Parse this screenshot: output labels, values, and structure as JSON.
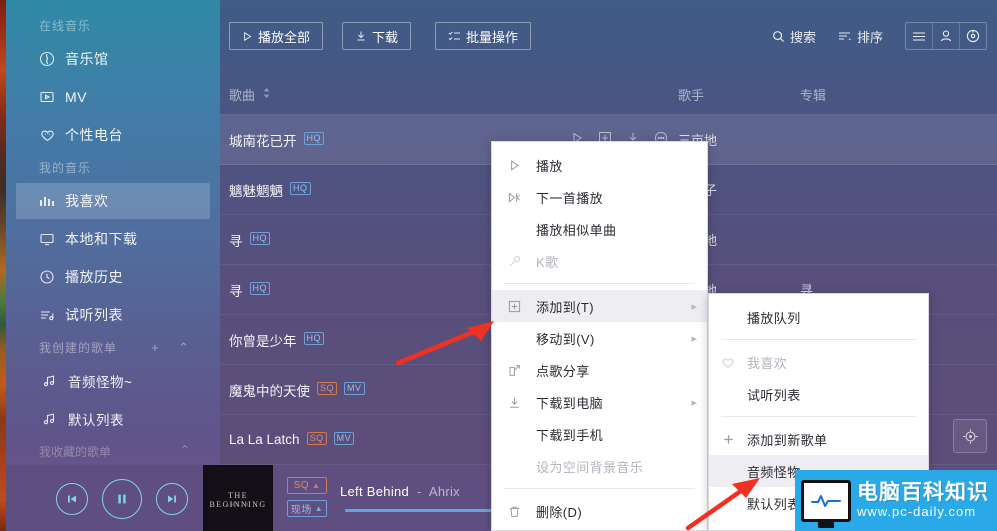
{
  "sidebar": {
    "groups": [
      {
        "title": "在线音乐",
        "items": [
          {
            "label": "音乐馆",
            "icon": "music-hall-icon"
          },
          {
            "label": "MV",
            "icon": "mv-icon"
          },
          {
            "label": "个性电台",
            "icon": "radio-heart-icon"
          }
        ]
      },
      {
        "title": "我的音乐",
        "items": [
          {
            "label": "我喜欢",
            "icon": "bars-icon",
            "active": true
          },
          {
            "label": "本地和下载",
            "icon": "monitor-icon"
          },
          {
            "label": "播放历史",
            "icon": "clock-icon"
          },
          {
            "label": "试听列表",
            "icon": "list-note-icon"
          }
        ]
      },
      {
        "title": "我创建的歌单",
        "add_label": "+",
        "collapse_label": "⌃",
        "items": [
          {
            "label": "音频怪物~",
            "icon": "note-icon"
          },
          {
            "label": "默认列表",
            "icon": "note-icon"
          }
        ]
      }
    ],
    "footer_group": {
      "title": "我收藏的歌单",
      "collapse_label": "⌃"
    }
  },
  "toolbar": {
    "play_all": "播放全部",
    "download": "下载",
    "batch": "批量操作",
    "search": "搜索",
    "sort": "排序",
    "menu_icon": "hamburger-icon",
    "user_icon": "user-icon",
    "skin_icon": "skin-disc-icon"
  },
  "columns": {
    "song": "歌曲",
    "artist": "歌手",
    "album": "专辑"
  },
  "rows": [
    {
      "title": "城南花已开",
      "badges": [
        {
          "t": "HQ",
          "k": "hq"
        }
      ],
      "artist": "三亩地",
      "album": "",
      "selected": true,
      "actions": [
        "play-icon",
        "add-icon",
        "download-icon",
        "more-icon"
      ]
    },
    {
      "title": "魑魅魍魉",
      "badges": [
        {
          "t": "HQ",
          "k": "hq"
        }
      ],
      "artist": "理理子",
      "album": ""
    },
    {
      "title": "寻",
      "badges": [
        {
          "t": "HQ",
          "k": "hq"
        }
      ],
      "artist": "三亩地",
      "album": ""
    },
    {
      "title": "寻",
      "badges": [
        {
          "t": "HQ",
          "k": "hq"
        }
      ],
      "artist": "三亩地",
      "album": "寻"
    },
    {
      "title": "你曾是少年",
      "badges": [
        {
          "t": "HQ",
          "k": "hq"
        }
      ],
      "artist": "",
      "album": ""
    },
    {
      "title": "魔鬼中的天使",
      "badges": [
        {
          "t": "SQ",
          "k": "sq"
        },
        {
          "t": "MV",
          "k": "mv"
        }
      ],
      "artist": "",
      "album": ""
    },
    {
      "title": "La La Latch",
      "badges": [
        {
          "t": "SQ",
          "k": "sq"
        },
        {
          "t": "MV",
          "k": "mv"
        }
      ],
      "artist": "",
      "album": ""
    }
  ],
  "context_menu": {
    "items": [
      {
        "label": "播放",
        "icon": "play-icon",
        "arrow": false,
        "disabled": false,
        "highlight": false
      },
      {
        "label": "下一首播放",
        "icon": "play-next-icon",
        "arrow": false,
        "disabled": false,
        "highlight": false
      },
      {
        "label": "播放相似单曲",
        "icon": "",
        "arrow": false,
        "disabled": false,
        "highlight": false
      },
      {
        "label": "K歌",
        "icon": "mic-icon",
        "arrow": false,
        "disabled": true,
        "highlight": false
      },
      {
        "sep": true
      },
      {
        "label": "添加到(T)",
        "icon": "plus-box-icon",
        "arrow": true,
        "disabled": false,
        "highlight": true
      },
      {
        "label": "移动到(V)",
        "icon": "",
        "arrow": true,
        "disabled": false,
        "highlight": false
      },
      {
        "label": "点歌分享",
        "icon": "share-icon",
        "arrow": false,
        "disabled": false,
        "highlight": false
      },
      {
        "label": "下载到电脑",
        "icon": "download-icon",
        "arrow": true,
        "disabled": false,
        "highlight": false
      },
      {
        "label": "下载到手机",
        "icon": "",
        "arrow": false,
        "disabled": false,
        "highlight": false
      },
      {
        "label": "设为空间背景音乐",
        "icon": "",
        "arrow": false,
        "disabled": true,
        "highlight": false
      },
      {
        "sep": true
      },
      {
        "label": "删除(D)",
        "icon": "trash-icon",
        "arrow": false,
        "disabled": false,
        "highlight": false
      }
    ]
  },
  "submenu": {
    "items": [
      {
        "label": "播放队列",
        "icon": "",
        "disabled": false,
        "highlight": false
      },
      {
        "sep": true
      },
      {
        "label": "我喜欢",
        "icon": "heart-icon",
        "disabled": true,
        "highlight": false
      },
      {
        "label": "试听列表",
        "icon": "",
        "disabled": false,
        "highlight": false
      },
      {
        "sep": true
      },
      {
        "label": "添加到新歌单",
        "icon": "plus-icon",
        "disabled": false,
        "highlight": false
      },
      {
        "label": "音频怪物~",
        "icon": "",
        "disabled": false,
        "highlight": true
      },
      {
        "label": "默认列表",
        "icon": "",
        "disabled": false,
        "highlight": false
      }
    ]
  },
  "player": {
    "prev_icon": "prev-icon",
    "pause_icon": "pause-icon",
    "next_icon": "next-icon",
    "cover_title": "THE BEGINNING",
    "cover_sub": "AHRIX",
    "quality_badge": "SQ",
    "live_badge": "现场",
    "song_title": "Left Behind",
    "separator": "-",
    "artist": "Ahrix",
    "locate_icon": "locate-target-icon"
  },
  "watermark": {
    "line1": "电脑百科知识",
    "line2": "www.pc-daily.com",
    "icon": "monitor-wave-icon"
  },
  "colors": {
    "sidebar_top": "#2f8aa6",
    "sidebar_bottom": "#6b5487",
    "main_top": "#3f5c87",
    "main_bottom": "#5d4d79",
    "player_bg": "#5e4f80",
    "accent_blue": "#5ea8e0",
    "badge_hq": "#8fc2ef",
    "badge_sq": "#e08a60",
    "arrow_red": "#f03020",
    "watermark_bg": "#29a9e8"
  }
}
